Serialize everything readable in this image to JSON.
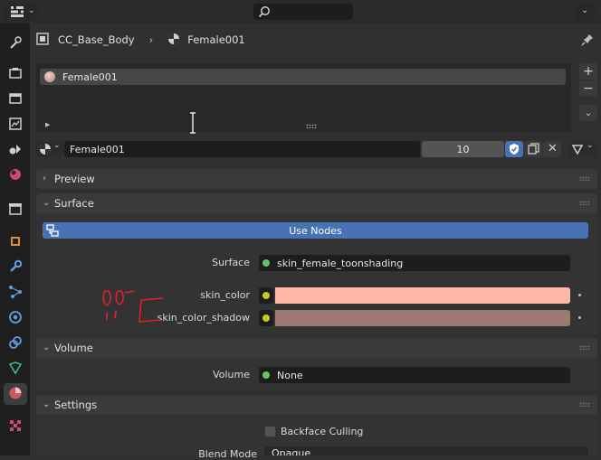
{
  "breadcrumb": {
    "object": "CC_Base_Body",
    "material": "Female001"
  },
  "slots": {
    "items": [
      {
        "label": "Female001"
      }
    ]
  },
  "material_selector": {
    "name": "Female001",
    "users": "10"
  },
  "panels": {
    "preview": "Preview",
    "surface": "Surface",
    "volume": "Volume",
    "settings": "Settings"
  },
  "surface": {
    "use_nodes_label": "Use Nodes",
    "surface_label": "Surface",
    "surface_value": "skin_female_toonshading",
    "skin_color_label": "skin_color",
    "skin_color_shadow_label": "skin_color_shadow"
  },
  "volume": {
    "volume_label": "Volume",
    "volume_value": "None"
  },
  "settings": {
    "backface_label": "Backface Culling",
    "blend_mode_label": "Blend Mode",
    "blend_mode_value": "Opaque"
  },
  "colors": {
    "use_nodes_bg": "#4772b3",
    "skin_color": "#ffbaa6",
    "skin_color_shadow": "#9b7872",
    "shader_socket": "#63c763",
    "color_socket": "#c7c729",
    "annotation": "#e0202a",
    "fake_user_blue": "#4772b3"
  },
  "icons": {
    "editor_type": "properties-editor-icon",
    "search": "search-icon",
    "pin": "pin-icon",
    "material": "material-sphere-icon"
  }
}
